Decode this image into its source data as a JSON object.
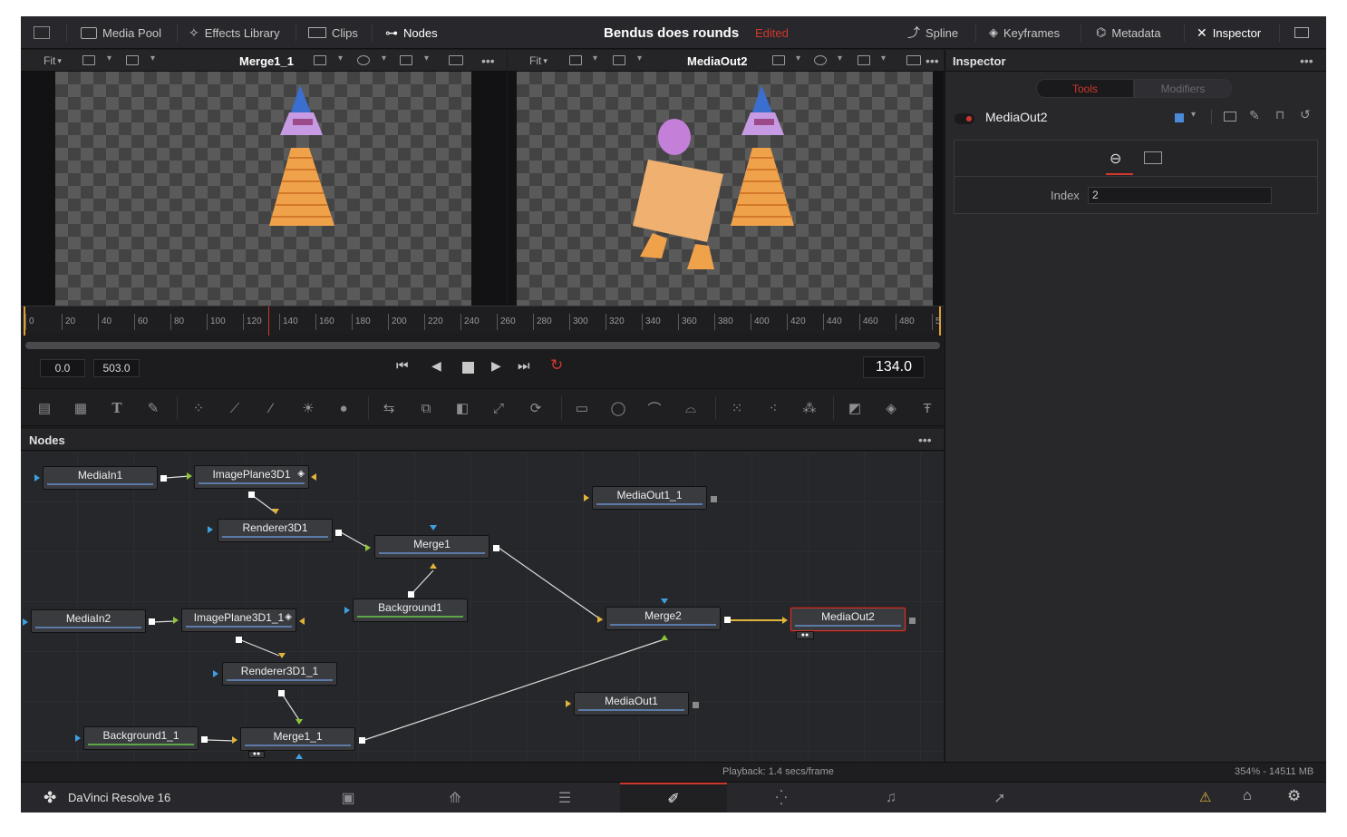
{
  "topbar": {
    "media_pool": "Media Pool",
    "effects_library": "Effects Library",
    "clips": "Clips",
    "nodes": "Nodes",
    "project_title": "Bendus does rounds",
    "edited": "Edited",
    "spline": "Spline",
    "keyframes": "Keyframes",
    "metadata": "Metadata",
    "inspector": "Inspector"
  },
  "viewer1": {
    "fit": "Fit",
    "title": "Merge1_1"
  },
  "viewer2": {
    "fit": "Fit",
    "title": "MediaOut2"
  },
  "ruler": {
    "ticks": [
      "0",
      "20",
      "40",
      "60",
      "80",
      "100",
      "120",
      "140",
      "160",
      "180",
      "200",
      "220",
      "240",
      "260",
      "280",
      "300",
      "320",
      "340",
      "360",
      "380",
      "400",
      "420",
      "440",
      "460",
      "480",
      "5"
    ]
  },
  "transport": {
    "start": "0.0",
    "end": "503.0",
    "current": "134.0"
  },
  "nodes_panel": {
    "title": "Nodes",
    "nodes": {
      "mediain1": "MediaIn1",
      "imageplane1": "ImagePlane3D1",
      "renderer1": "Renderer3D1",
      "merge1": "Merge1",
      "background1": "Background1",
      "mediain2": "MediaIn2",
      "imageplane2": "ImagePlane3D1_1",
      "renderer2": "Renderer3D1_1",
      "background2": "Background1_1",
      "merge1_1": "Merge1_1",
      "merge2": "Merge2",
      "mediaout1_1": "MediaOut1_1",
      "mediaout2": "MediaOut2",
      "mediaout1": "MediaOut1"
    }
  },
  "inspector": {
    "title": "Inspector",
    "tab_tools": "Tools",
    "tab_modifiers": "Modifiers",
    "node_name": "MediaOut2",
    "index_label": "Index",
    "index_value": "2"
  },
  "status": {
    "playback": "Playback: 1.4 secs/frame",
    "memory": "354% - 14511 MB"
  },
  "bottom": {
    "app_name": "DaVinci Resolve 16"
  },
  "colors": {
    "accent": "#d0372c",
    "wire": "#e0b43a",
    "selected_border": "#d0372c"
  }
}
